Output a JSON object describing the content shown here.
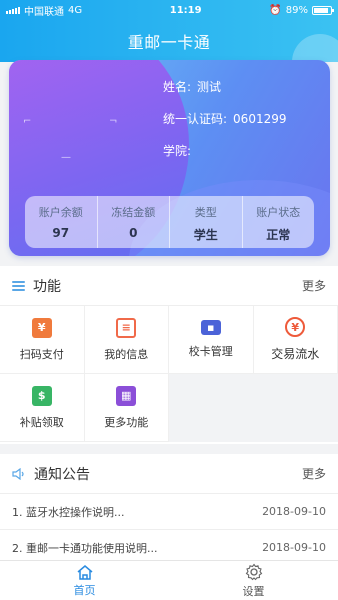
{
  "status_bar": {
    "carrier": "中国联通",
    "network": "4G",
    "time": "11:19",
    "battery": "89%",
    "battery_level": 0.89
  },
  "header": {
    "title": "重邮一卡通"
  },
  "card": {
    "name_label": "姓名:",
    "name_value": "测试",
    "auth_label": "统一认证码:",
    "auth_value": "0601299",
    "college_label": "学院:",
    "college_value": ""
  },
  "balance": {
    "items": [
      {
        "label": "账户余额",
        "value": "97"
      },
      {
        "label": "冻结金额",
        "value": "0"
      },
      {
        "label": "类型",
        "value": "学生"
      },
      {
        "label": "账户状态",
        "value": "正常"
      }
    ]
  },
  "functions": {
    "title": "功能",
    "more": "更多",
    "items": [
      {
        "label": "扫码支付",
        "icon": "scan-pay-icon",
        "color": "#f07a3c"
      },
      {
        "label": "我的信息",
        "icon": "my-info-icon",
        "color": "#f06a4a"
      },
      {
        "label": "校卡管理",
        "icon": "card-manage-icon",
        "color": "#4b63d8"
      },
      {
        "label": "交易流水",
        "icon": "transaction-icon",
        "color": "#ee5a3a"
      },
      {
        "label": "补贴领取",
        "icon": "subsidy-icon",
        "color": "#38b565"
      },
      {
        "label": "更多功能",
        "icon": "more-functions-icon",
        "color": "#8b4fd8"
      }
    ]
  },
  "notices": {
    "title": "通知公告",
    "more": "更多",
    "items": [
      {
        "text": "1. 蓝牙水控操作说明...",
        "date": "2018-09-10"
      },
      {
        "text": "2. 重邮一卡通功能使用说明...",
        "date": "2018-09-10"
      }
    ]
  },
  "tabs": {
    "home": "首页",
    "settings": "设置"
  },
  "colors": {
    "header": "#1aa6ef",
    "accent": "#2a8be0"
  }
}
